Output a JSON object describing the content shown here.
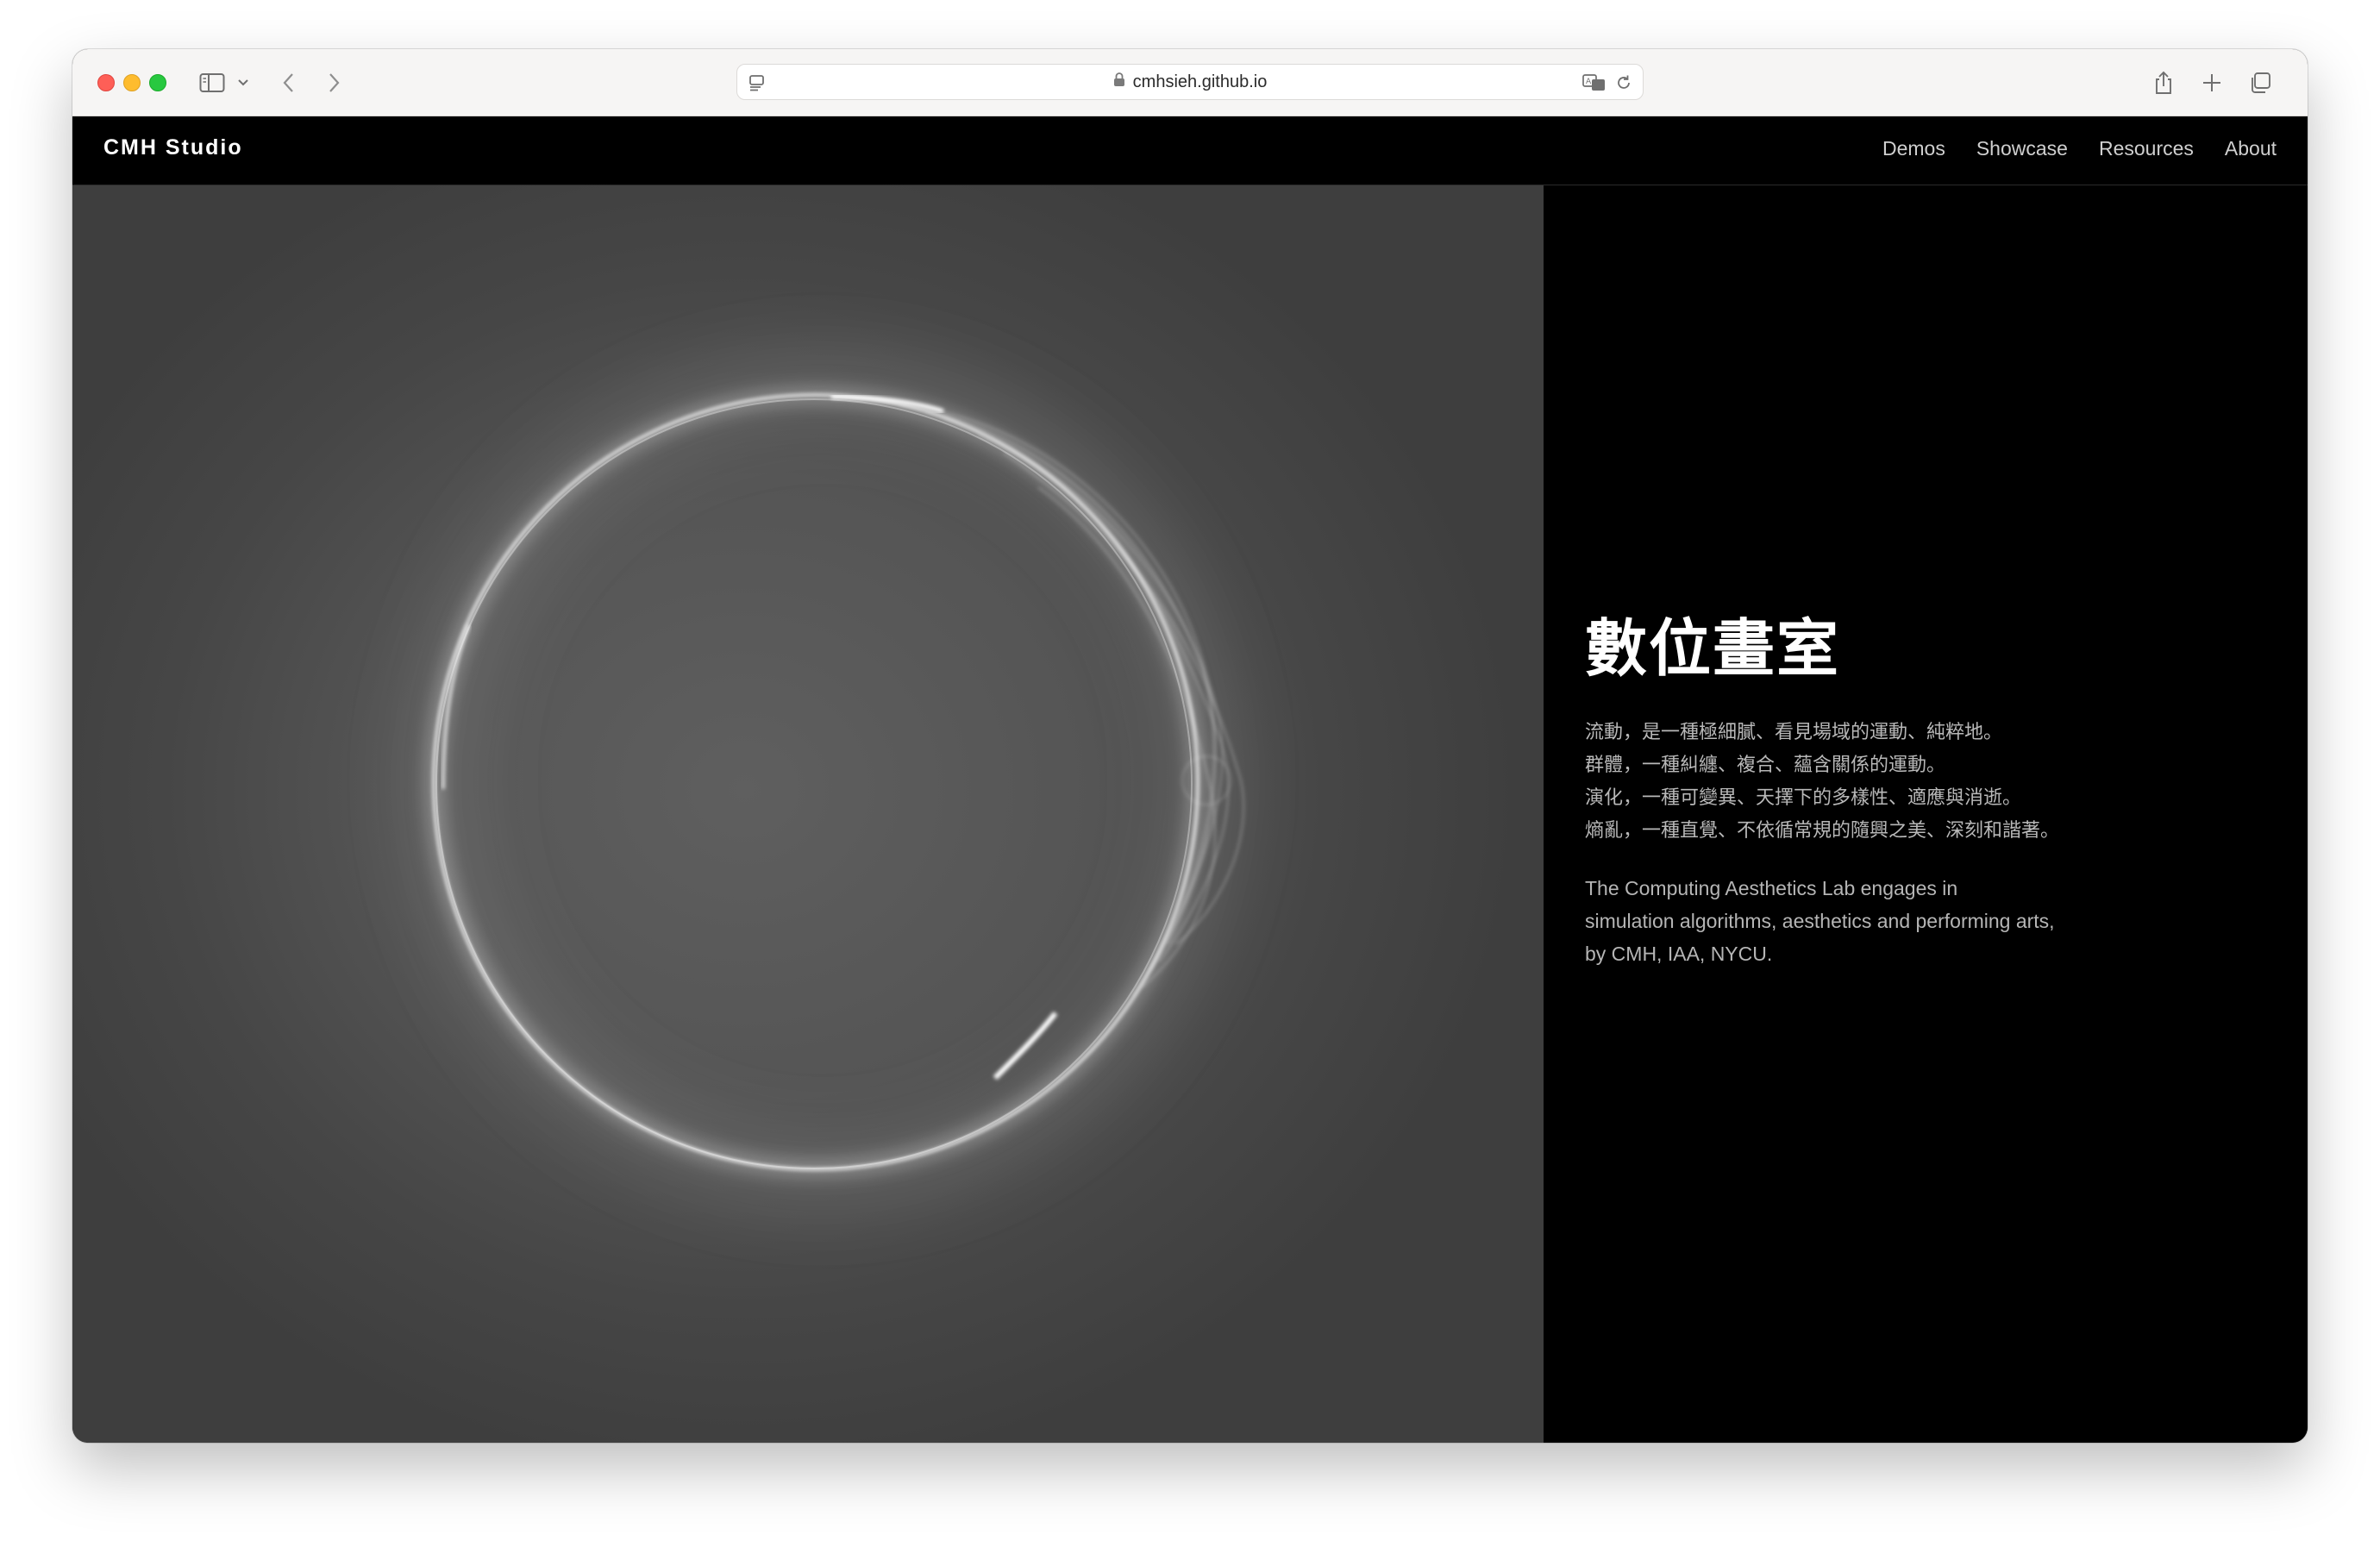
{
  "browser": {
    "url": "cmhsieh.github.io",
    "icons": [
      "sidebar-icon",
      "chevron-down-icon",
      "back-icon",
      "forward-icon",
      "page-menu-icon",
      "lock-icon",
      "translate-icon",
      "reload-icon",
      "share-icon",
      "new-tab-icon",
      "tab-overview-icon"
    ]
  },
  "site": {
    "brand": "CMH Studio",
    "nav": [
      {
        "label": "Demos"
      },
      {
        "label": "Showcase"
      },
      {
        "label": "Resources"
      },
      {
        "label": "About"
      }
    ]
  },
  "hero": {
    "title": "數位畫室",
    "poem": [
      "流動，是一種極細膩、看見場域的運動、純粹地。",
      "群體，一種糾纏、複合、蘊含關係的運動。",
      "演化，一種可變異、天擇下的多樣性、適應與消逝。",
      "熵亂，一種直覺、不依循常規的隨興之美、深刻和諧著。"
    ],
    "description": [
      "The Computing Aesthetics Lab engages in",
      "simulation algorithms, aesthetics and performing arts,",
      "by CMH, IAA, NYCU."
    ]
  },
  "colors": {
    "background": "#000000",
    "hero_gray": "#555555",
    "text_primary": "#ffffff",
    "text_secondary": "#b8b8b8"
  }
}
